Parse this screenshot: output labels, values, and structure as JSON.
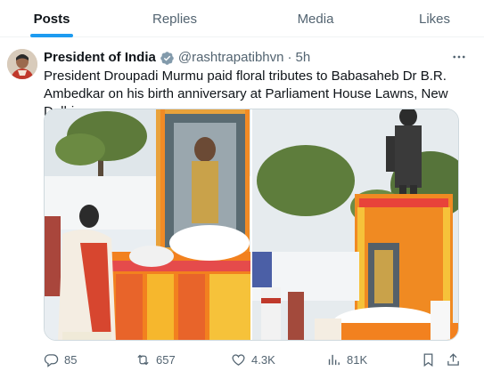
{
  "tabs": [
    {
      "label": "Posts",
      "active": true
    },
    {
      "label": "Replies",
      "active": false
    },
    {
      "label": "Media",
      "active": false
    },
    {
      "label": "Likes",
      "active": false
    }
  ],
  "tweet": {
    "author_name": "President of India",
    "handle": "@rashtrapatibhvn",
    "separator": "·",
    "time": "5h",
    "text": "President Droupadi Murmu paid floral tributes to Babasaheb Dr B.R. Ambedkar on his birth anniversary at Parliament House Lawns, New Delhi.",
    "verified_badge_color": "#829aab",
    "stats": {
      "replies": "85",
      "reposts": "657",
      "likes": "4.3K",
      "views": "81K"
    }
  },
  "colors": {
    "accent": "#1d9bf0",
    "secondary_text": "#536471",
    "primary_text": "#0f1419"
  },
  "icons": [
    "verified-badge-icon",
    "more-icon",
    "reply-icon",
    "repost-icon",
    "like-icon",
    "views-icon",
    "bookmark-icon",
    "share-icon"
  ]
}
